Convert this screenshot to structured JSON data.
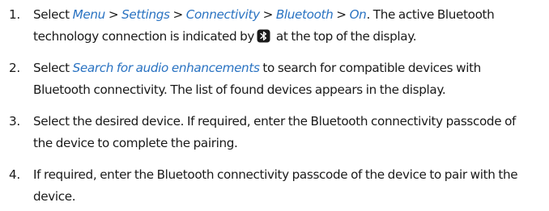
{
  "steps": [
    {
      "number": "1.",
      "text_a": "Select ",
      "menu": "Menu",
      "sep1": " > ",
      "settings": "Settings",
      "sep2": " > ",
      "connectivity": "Connectivity",
      "sep3": " > ",
      "bluetooth": "Bluetooth",
      "sep4": " > ",
      "on": "On",
      "text_b": ". The active Bluetooth technology connection is indicated by",
      "icon": "bluetooth-status-icon",
      "text_c": " at the top of the display."
    },
    {
      "number": "2.",
      "text_a": "Select ",
      "link": "Search for audio enhancements",
      "text_b": " to search for compatible devices with Bluetooth connectivity. The list of found devices appears in the display."
    },
    {
      "number": "3.",
      "text": "Select the desired device. If required, enter the Bluetooth connectivity passcode of the device to complete the pairing."
    },
    {
      "number": "4.",
      "text": "If required, enter the Bluetooth connectivity passcode of the device to pair with the device."
    }
  ],
  "colors": {
    "body_text": "#1a1a1a",
    "ui_term": "#2a73c2",
    "icon_fill": "#1a1a1a"
  }
}
